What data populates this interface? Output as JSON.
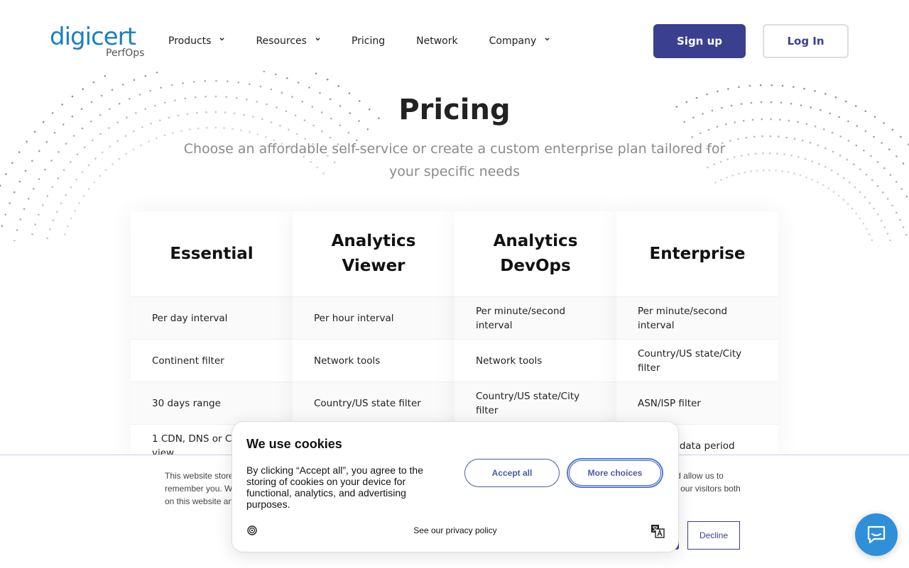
{
  "header": {
    "logo_main": "digicert",
    "logo_sub": "PerfOps",
    "nav": [
      {
        "label": "Products",
        "has_dropdown": true
      },
      {
        "label": "Resources",
        "has_dropdown": true
      },
      {
        "label": "Pricing",
        "has_dropdown": false
      },
      {
        "label": "Network",
        "has_dropdown": false
      },
      {
        "label": "Company",
        "has_dropdown": true
      }
    ],
    "signup_label": "Sign up",
    "login_label": "Log In"
  },
  "hero": {
    "title": "Pricing",
    "subtitle": "Choose an affordable self-service or create a custom enterprise plan tailored for your specific needs"
  },
  "plans": [
    {
      "name": "Essential",
      "rows": [
        "Per day interval",
        "Continent filter",
        "30 days range",
        "1 CDN, DNS or Cloud view"
      ]
    },
    {
      "name": "Analytics Viewer",
      "rows": [
        "Per hour interval",
        "Network tools",
        "Country/US state filter",
        ""
      ]
    },
    {
      "name": "Analytics DevOps",
      "rows": [
        "Per minute/second interval",
        "Network tools",
        "Country/US state/City filter",
        ""
      ]
    },
    {
      "name": "Enterprise",
      "rows": [
        "Per minute/second interval",
        "Country/US state/City filter",
        "ASN/ISP filter",
        "data period"
      ],
      "highlight": "ed"
    }
  ],
  "consent_bar": {
    "text": "This website stores cookies on your computer. These cookies are used to collect information about how you interact with our website and allow us to remember you. We use this information in order to improve and customize your browsing experience and for analytics and metrics about our visitors both on this website and other media.",
    "decline_label": "Decline"
  },
  "cookie_popup": {
    "title": "We use cookies",
    "body": "By clicking “Accept all”, you agree to the storing of cookies on your device for functional, analytics, and advertising purposes.",
    "accept_label": "Accept all",
    "more_label": "More choices",
    "privacy_label": "See our privacy policy"
  },
  "colors": {
    "brand": "#1b7fc3",
    "primary_button": "#3a3f8f",
    "highlight": "#1cc3a8",
    "chat": "#2f8fd8"
  },
  "icons": {
    "nav_dropdown": "chevron-down-icon",
    "cookie_settings": "gear-icon",
    "cookie_language": "translate-icon",
    "chat": "chat-bubble-icon"
  }
}
